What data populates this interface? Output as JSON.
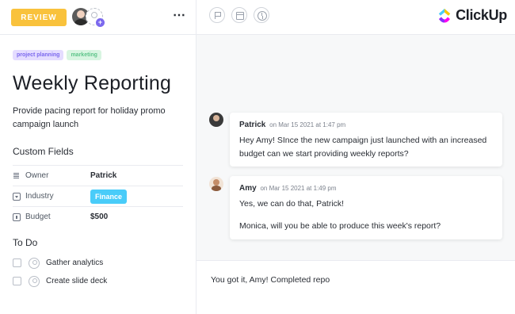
{
  "header": {
    "status_label": "REVIEW",
    "status_color": "#f9c23c",
    "more_icon": "⋯"
  },
  "task": {
    "tags": [
      {
        "label": "project planning",
        "color": "#7b68ee"
      },
      {
        "label": "marketing",
        "color": "#5ec48a"
      }
    ],
    "title": "Weekly Reporting",
    "description": "Provide pacing report for holiday promo campaign launch"
  },
  "custom_fields": {
    "heading": "Custom Fields",
    "rows": [
      {
        "icon": "text-lines-icon",
        "label": "Owner",
        "value": "Patrick"
      },
      {
        "icon": "dropdown-icon",
        "label": "Industry",
        "value": "Finance",
        "badge_color": "#49ccf9"
      },
      {
        "icon": "currency-icon",
        "label": "Budget",
        "value": "$500"
      }
    ]
  },
  "todo": {
    "heading": "To Do",
    "items": [
      {
        "label": "Gather analytics",
        "checked": false
      },
      {
        "label": "Create slide deck",
        "checked": false
      }
    ]
  },
  "toolbar": {
    "icons": [
      "flag-icon",
      "calendar-icon",
      "clock-icon"
    ],
    "logo_text": "ClickUp"
  },
  "comments": [
    {
      "author": "Patrick",
      "meta": "on Mar 15 2021 at 1:47 pm",
      "body": "Hey Amy! SInce the new campaign just launched with an increased budget can we start providing weekly reports?"
    },
    {
      "author": "Amy",
      "meta": "on Mar 15 2021 at 1:49 pm",
      "body": "Yes, we can do that, Patrick!",
      "body2": "Monica, will you be able to produce this week's report?"
    }
  ],
  "composer": {
    "value": "You got it, Amy! Completed repo"
  }
}
